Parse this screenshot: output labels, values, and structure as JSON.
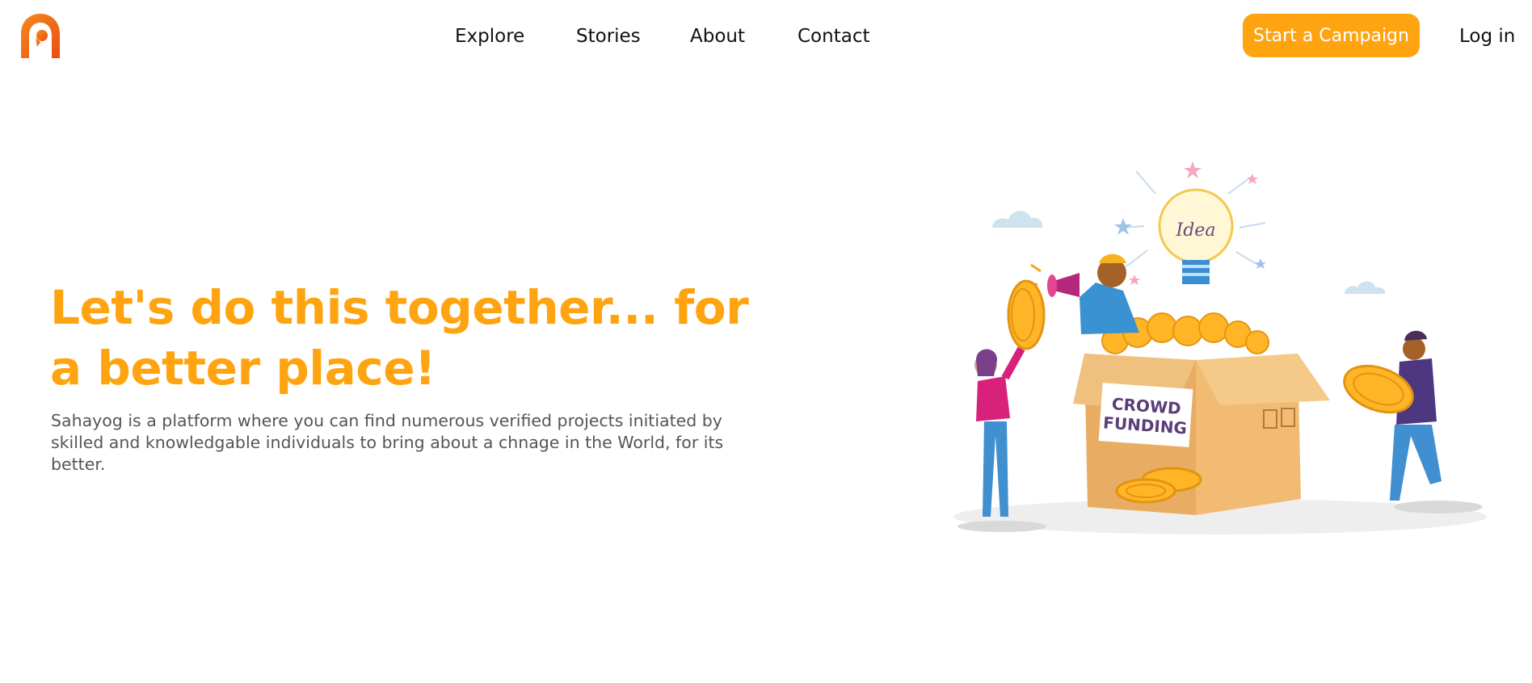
{
  "brand": {
    "logo_icon": "sahayog-logo-icon",
    "accent_color": "#ffa411",
    "logo_color": "#f26a1b"
  },
  "nav": {
    "links": [
      {
        "label": "Explore"
      },
      {
        "label": "Stories"
      },
      {
        "label": "About"
      },
      {
        "label": "Contact"
      }
    ],
    "cta_label": "Start a Campaign",
    "login_label": "Log in"
  },
  "hero": {
    "title": "Let's do this together... for a better place!",
    "description": "Sahayog is a platform where you can find numerous verified projects initiated by skilled and knowledgable individuals to bring about a chnage in the World, for its better.",
    "illustration": {
      "icon": "crowdfunding-illustration",
      "box_label_line1": "CROWD",
      "box_label_line2": "FUNDING",
      "bulb_text": "Idea"
    }
  }
}
